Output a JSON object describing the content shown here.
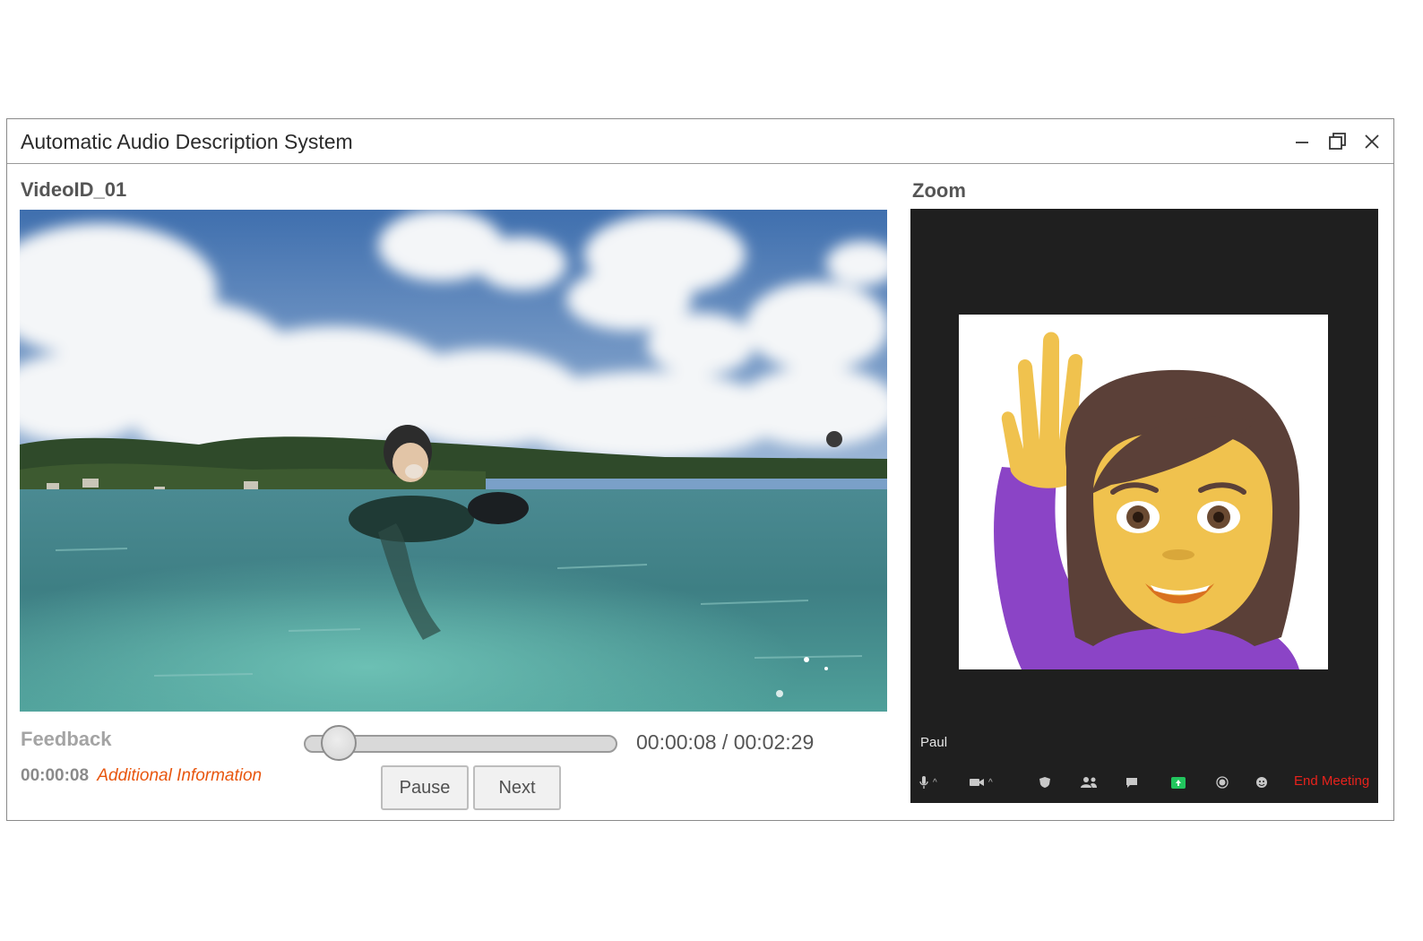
{
  "window": {
    "title": "Automatic Audio Description System",
    "controls": [
      "minimize-icon",
      "restore-icon",
      "close-icon"
    ]
  },
  "video": {
    "id_label": "VideoID_01",
    "scene": "ocean-surfer-video-frame"
  },
  "feedback": {
    "label": "Feedback",
    "timestamp": "00:00:08",
    "info_link": "Additional Information"
  },
  "player": {
    "progress_fraction": 0.054,
    "time_display": "00:00:08 / 00:02:29",
    "pause_label": "Pause",
    "next_label": "Next"
  },
  "zoom": {
    "label": "Zoom",
    "participant_name": "Paul",
    "avatar": "woman-raising-hand-emoji",
    "toolbar_icons": [
      "microphone-icon",
      "video-camera-icon",
      "security-shield-icon",
      "participants-icon",
      "chat-icon",
      "share-screen-icon",
      "record-icon",
      "reactions-icon"
    ],
    "end_meeting_label": "End Meeting",
    "colors": {
      "panel": "#1f1f1f",
      "end_meeting": "#e8221c",
      "share_green": "#22c55e"
    }
  },
  "colors": {
    "feedback_info": "#e8560f",
    "section_label": "#555555"
  }
}
